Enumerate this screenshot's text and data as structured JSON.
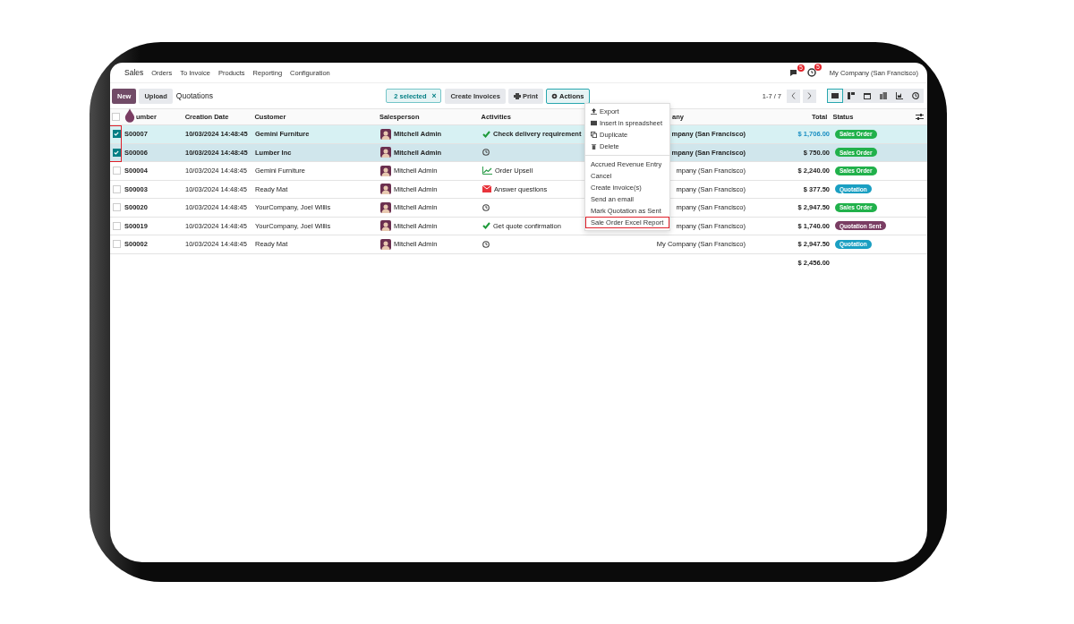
{
  "nav": {
    "app": "Sales",
    "items": [
      "Orders",
      "To Invoice",
      "Products",
      "Reporting",
      "Configuration"
    ],
    "badges": [
      "5",
      "5"
    ],
    "company": "My Company (San Francisco)"
  },
  "control": {
    "new": "New",
    "upload": "Upload",
    "title": "Quotations",
    "selection": "2 selected",
    "clear": "×",
    "buttons": [
      "Create Invoices",
      "Print"
    ],
    "actions": "Actions",
    "pager": "1-7 / 7",
    "views": [
      {
        "kind": "list",
        "selected": true
      },
      {
        "kind": "kanban",
        "selected": false
      },
      {
        "kind": "calendar",
        "selected": false
      },
      {
        "kind": "pivot",
        "selected": false
      },
      {
        "kind": "graph",
        "selected": false
      },
      {
        "kind": "activity",
        "selected": false
      }
    ]
  },
  "menu": {
    "groups": [
      [
        {
          "kind": "export",
          "label": "Export"
        },
        {
          "kind": "spreadsheet",
          "label": "Insert in spreadsheet"
        },
        {
          "kind": "duplicate",
          "label": "Duplicate"
        },
        {
          "kind": "delete",
          "label": "Delete"
        }
      ],
      [
        {
          "label": "Accrued Revenue Entry",
          "highlighted": false
        },
        {
          "label": "Cancel",
          "highlighted": false
        },
        {
          "label": "Create invoice(s)",
          "highlighted": false
        },
        {
          "label": "Send an email",
          "highlighted": false
        },
        {
          "label": "Mark Quotation as Sent",
          "highlighted": false
        },
        {
          "label": "Sale Order Excel Report",
          "highlighted": true
        }
      ]
    ]
  },
  "table": {
    "select_all": {
      "checked": false
    },
    "columns": [
      "umber",
      "Creation Date",
      "Customer",
      "Salesperson",
      "Activities",
      "any",
      "Total",
      "Status"
    ],
    "rows": [
      {
        "selected": true,
        "number": "S00007",
        "date": "10/03/2024 14:48:45",
        "customer": "Gemini Furniture",
        "salesperson": "Mitchell Admin",
        "activity": {
          "kind": "check",
          "text": "Check delivery requirement"
        },
        "company": "mpany (San Francisco)",
        "total": "$ 1,706.00",
        "total_highlighted": true,
        "status": {
          "text": "Sales Order",
          "color": "#21b14b"
        }
      },
      {
        "selected": true,
        "number": "S00006",
        "date": "10/03/2024 14:48:45",
        "customer": "Lumber Inc",
        "salesperson": "Mitchell Admin",
        "activity": {
          "kind": "clock"
        },
        "company": "mpany (San Francisco)",
        "total": "$ 750.00",
        "total_highlighted": false,
        "status": {
          "text": "Sales Order",
          "color": "#21b14b"
        }
      },
      {
        "selected": false,
        "number": "S00004",
        "date": "10/03/2024 14:48:45",
        "customer": "Gemini Furniture",
        "salesperson": "Mitchell Admin",
        "activity": {
          "kind": "upsell",
          "text": "Order Upsell"
        },
        "company": "mpany (San Francisco)",
        "total": "$ 2,240.00",
        "total_highlighted": false,
        "status": {
          "text": "Sales Order",
          "color": "#21b14b"
        }
      },
      {
        "selected": false,
        "number": "S00003",
        "date": "10/03/2024 14:48:45",
        "customer": "Ready Mat",
        "salesperson": "Mitchell Admin",
        "activity": {
          "kind": "email",
          "text": "Answer questions"
        },
        "company": "mpany (San Francisco)",
        "total": "$ 377.50",
        "total_highlighted": false,
        "status": {
          "text": "Quotation",
          "color": "#1a9fc2"
        }
      },
      {
        "selected": false,
        "number": "S00020",
        "date": "10/03/2024 14:48:45",
        "customer": "YourCompany, Joel Willis",
        "salesperson": "Mitchell Admin",
        "activity": {
          "kind": "clock"
        },
        "company": "mpany (San Francisco)",
        "total": "$ 2,947.50",
        "total_highlighted": false,
        "status": {
          "text": "Sales Order",
          "color": "#21b14b"
        }
      },
      {
        "selected": false,
        "number": "S00019",
        "date": "10/03/2024 14:48:45",
        "customer": "YourCompany, Joel Willis",
        "salesperson": "Mitchell Admin",
        "activity": {
          "kind": "check",
          "text": "Get quote confirmation"
        },
        "company": "mpany (San Francisco)",
        "total": "$ 1,740.00",
        "total_highlighted": false,
        "status": {
          "text": "Quotation Sent",
          "color": "#7a3d63"
        }
      },
      {
        "selected": false,
        "number": "S00002",
        "date": "10/03/2024 14:48:45",
        "customer": "Ready Mat",
        "salesperson": "Mitchell Admin",
        "activity": {
          "kind": "clock"
        },
        "company": "My Company (San Francisco)",
        "total": "$ 2,947.50",
        "total_highlighted": false,
        "status": {
          "text": "Quotation",
          "color": "#1a9fc2"
        }
      }
    ],
    "sum": "$ 2,456.00"
  }
}
